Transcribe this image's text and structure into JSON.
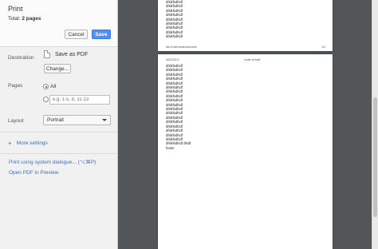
{
  "header": {
    "title": "Print",
    "summary_label": "Total:",
    "summary_value": "2 pages",
    "cancel_label": "Cancel",
    "save_label": "Save"
  },
  "destination": {
    "label": "Destination",
    "value": "Save as PDF",
    "change_label": "Change..."
  },
  "pages": {
    "label": "Pages",
    "all_label": "All",
    "custom_placeholder": "e.g. 1-5, 8, 11-13"
  },
  "layout": {
    "label": "Layout",
    "value": "Portrait"
  },
  "more_settings": {
    "icon": "+",
    "label": "More settings"
  },
  "links": {
    "system_dialog": "Print using system dialogue... (⌥⌘P)",
    "open_pdf": "Open PDF in Preview"
  },
  "preview": {
    "page1": {
      "lines": [
        "dfslkfsdfsdf",
        "dfslkfsdfsdf",
        "dfslkfsdfsdf",
        "dfslkfsdfsdf",
        "dfslkfsdfsdf",
        "dfslkfsdfsdf",
        "dfslkfsdfsdf",
        "dfslkfsdfsdf",
        "dfslkfsdfsdf"
      ],
      "footer_left": "file:///Users/test/ztest.html",
      "footer_right": "1/2"
    },
    "page2": {
      "header_left": "06/12/2017",
      "header_center": "footer at itself",
      "lines": [
        "dfslkfsdfsdf",
        "dfslkfsdfsdf",
        "dfslkfsdfsdf",
        "dfslkfsdfsdf",
        "dfslkfsdfsdf",
        "dfslkfsdfsdf",
        "dfslkfsdfsdf",
        "dfslkfsdfsdf",
        "dfslkfsdfsdf",
        "dfslkfsdfsdf",
        "dfslkfsdfsdf",
        "dfslkfsdfsdf",
        "dfslkfsdfsdf",
        "dfslkfsdfsdf",
        "dfslkfsdfsdf",
        "dfslkfsdfsdf",
        "dfslkfsdfsdf",
        "dfslkfsdfsdf",
        "dfslkfsdfsdf dfsdf",
        "footer"
      ]
    }
  },
  "colors": {
    "accent": "#4d90fe",
    "link": "#3b6fbf",
    "preview_bg": "#525659"
  }
}
